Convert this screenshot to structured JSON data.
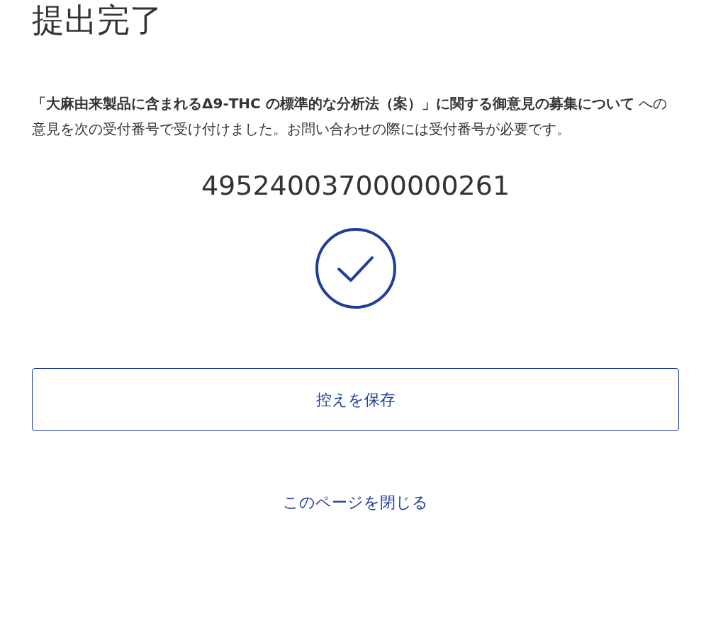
{
  "title": "提出完了",
  "message": "**「大麻由来製品に含まれるΔ9-THC の標準的な分析法（案）」に関する御意見の募集について** への意見を次の受付番号で受け付けました。お問い合わせの際には受付番号が必要です。",
  "receipt_number": "495240037000000261",
  "save_button": "控えを保存",
  "close_link": "このページを閉じる"
}
